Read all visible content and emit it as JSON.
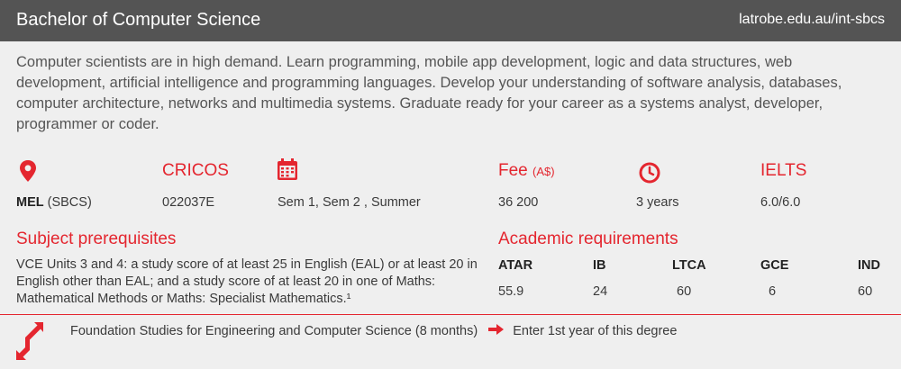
{
  "header": {
    "title": "Bachelor of Computer Science",
    "url": "latrobe.edu.au/int-sbcs"
  },
  "description": "Computer scientists are in high demand. Learn programming, mobile app development, logic and data structures, web development, artificial intelligence and programming languages. Develop your understanding of software analysis, databases, computer architecture, networks and multimedia systems. Graduate ready for your career as a systems analyst, developer, programmer or coder.",
  "info": {
    "location": {
      "icon": "location-pin-icon",
      "campus": "MEL",
      "code": "(SBCS)"
    },
    "cricos": {
      "label": "CRICOS",
      "value": "022037E"
    },
    "intake": {
      "icon": "calendar-icon",
      "value": "Sem 1, Sem 2 , Summer"
    },
    "fee": {
      "label": "Fee",
      "unit": "(A$)",
      "value": "36 200"
    },
    "duration": {
      "icon": "clock-icon",
      "value": "3 years"
    },
    "ielts": {
      "label": "IELTS",
      "value": "6.0/6.0"
    }
  },
  "prerequisites": {
    "heading": "Subject prerequisites",
    "text": "VCE Units 3 and 4: a study score of at least 25 in English (EAL) or at least 20 in English other than EAL; and a study score of at least 20 in one of Maths: Mathematical Methods or Maths: Specialist Mathematics.¹"
  },
  "academic": {
    "heading": "Academic requirements",
    "columns": [
      "ATAR",
      "IB",
      "LTCA",
      "GCE",
      "IND"
    ],
    "values": [
      "55.9",
      "24",
      "60",
      "6",
      "60"
    ]
  },
  "pathway": {
    "icon": "pathway-arrow-icon",
    "from": "Foundation Studies for Engineering and Computer Science (8 months)",
    "arrow_icon": "right-arrow-icon",
    "to": "Enter 1st year of this degree"
  },
  "colors": {
    "accent": "#e4262f",
    "header_bg": "#545454",
    "card_bg": "#efefef"
  }
}
